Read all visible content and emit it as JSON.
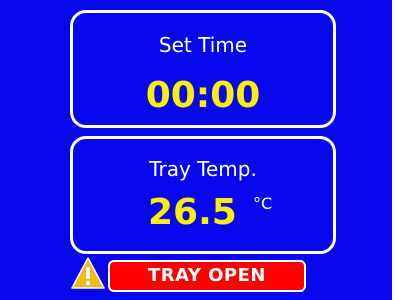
{
  "set_time": {
    "label": "Set Time",
    "value": "00:00"
  },
  "tray_temp": {
    "label": "Tray Temp.",
    "value": "26.5",
    "unit": "°C"
  },
  "status": {
    "icon": "warning-icon",
    "text": "TRAY OPEN"
  },
  "colors": {
    "background": "#0707ec",
    "value_text": "#ffef00",
    "alert": "#ff0000",
    "warning_icon": "#f5b818"
  }
}
